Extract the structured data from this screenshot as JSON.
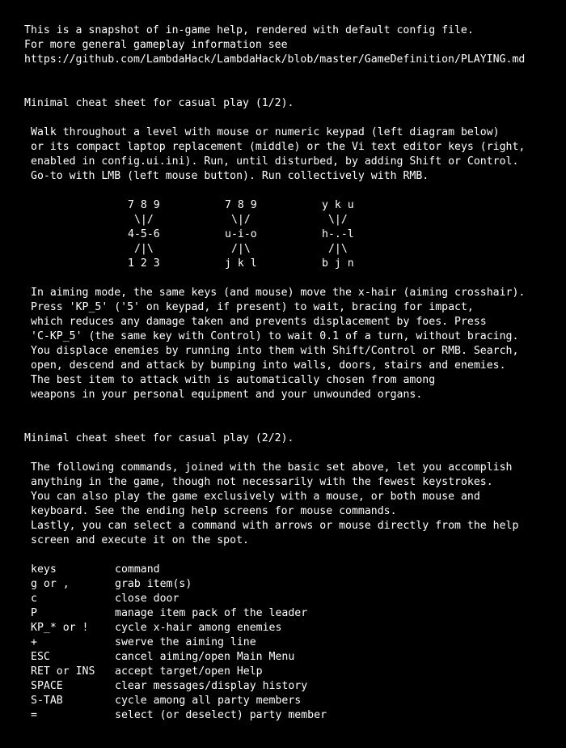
{
  "intro": {
    "line1": "This is a snapshot of in-game help, rendered with default config file.",
    "line2": "For more general gameplay information see",
    "line3": "https://github.com/LambdaHack/LambdaHack/blob/master/GameDefinition/PLAYING.md"
  },
  "sheet1": {
    "title": "Minimal cheat sheet for casual play (1/2).",
    "para1": [
      "Walk throughout a level with mouse or numeric keypad (left diagram below)",
      "or its compact laptop replacement (middle) or the Vi text editor keys (right,",
      "enabled in config.ui.ini). Run, until disturbed, by adding Shift or Control.",
      "Go-to with LMB (left mouse button). Run collectively with RMB."
    ],
    "diagram": {
      "keypad": [
        "7 8 9",
        " \\|/",
        "4-5-6",
        " /|\\",
        "1 2 3"
      ],
      "laptop": [
        "7 8 9",
        " \\|/",
        "u-i-o",
        " /|\\",
        "j k l"
      ],
      "vi": [
        "y k u",
        " \\|/",
        "h-.-l",
        " /|\\",
        "b j n"
      ]
    },
    "para2": [
      "In aiming mode, the same keys (and mouse) move the x-hair (aiming crosshair).",
      "Press 'KP_5' ('5' on keypad, if present) to wait, bracing for impact,",
      "which reduces any damage taken and prevents displacement by foes. Press",
      "'C-KP_5' (the same key with Control) to wait 0.1 of a turn, without bracing.",
      "You displace enemies by running into them with Shift/Control or RMB. Search,",
      "open, descend and attack by bumping into walls, doors, stairs and enemies.",
      "The best item to attack with is automatically chosen from among",
      "weapons in your personal equipment and your unwounded organs."
    ]
  },
  "sheet2": {
    "title": "Minimal cheat sheet for casual play (2/2).",
    "para1": [
      "The following commands, joined with the basic set above, let you accomplish",
      "anything in the game, though not necessarily with the fewest keystrokes.",
      "You can also play the game exclusively with a mouse, or both mouse and",
      "keyboard. See the ending help screens for mouse commands.",
      "Lastly, you can select a command with arrows or mouse directly from the help",
      "screen and execute it on the spot."
    ],
    "table_header": {
      "keys": "keys",
      "command": "command"
    },
    "commands": [
      {
        "keys": "g or ,",
        "command": "grab item(s)"
      },
      {
        "keys": "c",
        "command": "close door"
      },
      {
        "keys": "P",
        "command": "manage item pack of the leader"
      },
      {
        "keys": "KP_* or !",
        "command": "cycle x-hair among enemies"
      },
      {
        "keys": "+",
        "command": "swerve the aiming line"
      },
      {
        "keys": "ESC",
        "command": "cancel aiming/open Main Menu"
      },
      {
        "keys": "RET or INS",
        "command": "accept target/open Help"
      },
      {
        "keys": "SPACE",
        "command": "clear messages/display history"
      },
      {
        "keys": "S-TAB",
        "command": "cycle among all party members"
      },
      {
        "keys": "=",
        "command": "select (or deselect) party member"
      }
    ]
  }
}
